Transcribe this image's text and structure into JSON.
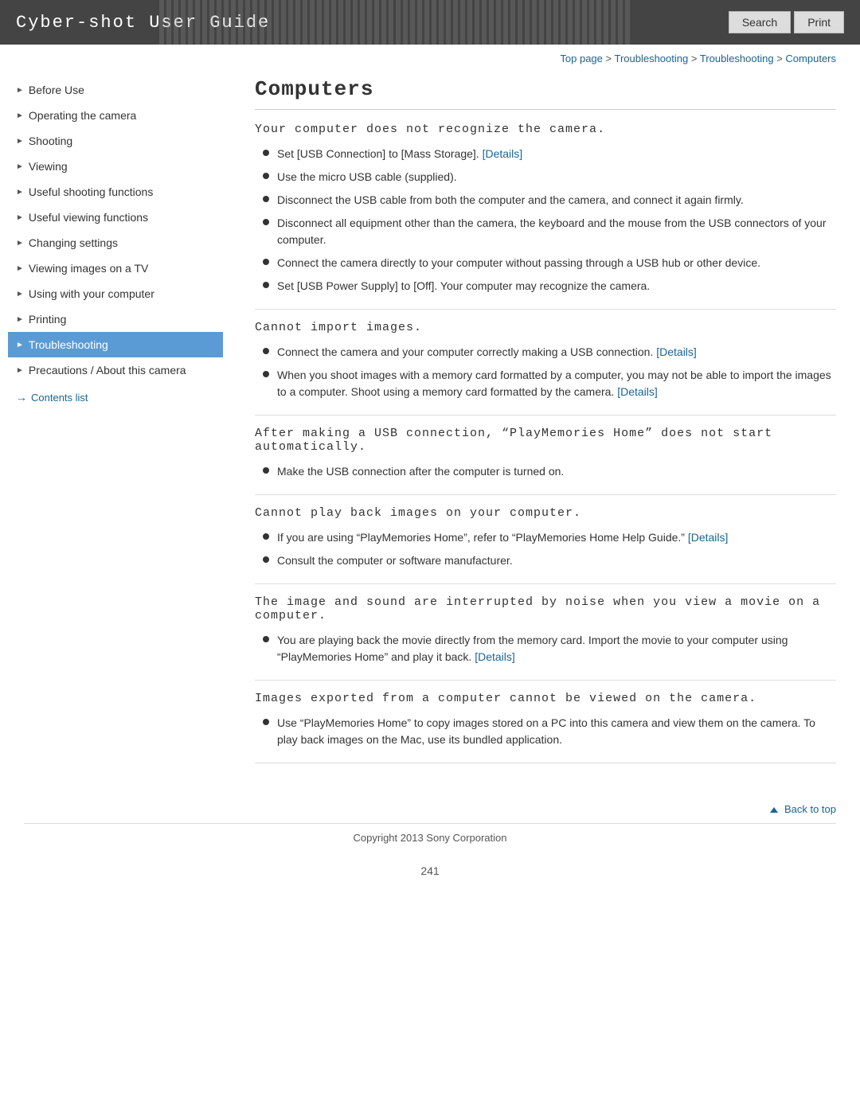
{
  "header": {
    "title": "Cyber-shot User Guide",
    "search_label": "Search",
    "print_label": "Print"
  },
  "breadcrumb": {
    "items": [
      {
        "text": "Top page",
        "link": true
      },
      {
        "text": " > "
      },
      {
        "text": "Troubleshooting",
        "link": true
      },
      {
        "text": " > "
      },
      {
        "text": "Troubleshooting",
        "link": true
      },
      {
        "text": " > "
      },
      {
        "text": "Computers",
        "link": true
      }
    ]
  },
  "sidebar": {
    "items": [
      {
        "label": "Before Use",
        "active": false
      },
      {
        "label": "Operating the camera",
        "active": false
      },
      {
        "label": "Shooting",
        "active": false
      },
      {
        "label": "Viewing",
        "active": false
      },
      {
        "label": "Useful shooting functions",
        "active": false
      },
      {
        "label": "Useful viewing functions",
        "active": false
      },
      {
        "label": "Changing settings",
        "active": false
      },
      {
        "label": "Viewing images on a TV",
        "active": false
      },
      {
        "label": "Using with your computer",
        "active": false
      },
      {
        "label": "Printing",
        "active": false
      },
      {
        "label": "Troubleshooting",
        "active": true
      },
      {
        "label": "Precautions / About this camera",
        "active": false
      }
    ],
    "contents_list": "Contents list"
  },
  "main": {
    "page_title": "Computers",
    "sections": [
      {
        "id": "section1",
        "heading": "Your computer does not recognize the camera.",
        "bullets": [
          {
            "text": "Set [USB Connection] to [Mass Storage]. ",
            "link_text": "[Details]"
          },
          {
            "text": "Use the micro USB cable (supplied)."
          },
          {
            "text": "Disconnect the USB cable from both the computer and the camera, and connect it again firmly."
          },
          {
            "text": "Disconnect all equipment other than the camera, the keyboard and the mouse from the USB connectors of your computer."
          },
          {
            "text": "Connect the camera directly to your computer without passing through a USB hub or other device."
          },
          {
            "text": "Set [USB Power Supply] to [Off]. Your computer may recognize the camera."
          }
        ]
      },
      {
        "id": "section2",
        "heading": "Cannot import images.",
        "bullets": [
          {
            "text": "Connect the camera and your computer correctly making a USB connection. ",
            "link_text": "[Details]"
          },
          {
            "text": "When you shoot images with a memory card formatted by a computer, you may not be able to import the images to a computer. Shoot using a memory card formatted by the camera. ",
            "link_text": "[Details]"
          }
        ]
      },
      {
        "id": "section3",
        "heading": "After making a USB connection, “PlayMemories Home” does not start automatically.",
        "bullets": [
          {
            "text": "Make the USB connection after the computer is turned on."
          }
        ]
      },
      {
        "id": "section4",
        "heading": "Cannot play back images on your computer.",
        "bullets": [
          {
            "text": "If you are using “PlayMemories Home”, refer to “PlayMemories Home Help Guide.” ",
            "link_text": "[Details]"
          },
          {
            "text": "Consult the computer or software manufacturer."
          }
        ]
      },
      {
        "id": "section5",
        "heading": "The image and sound are interrupted by noise when you view a movie on a computer.",
        "bullets": [
          {
            "text": "You are playing back the movie directly from the memory card. Import the movie to your computer using “PlayMemories Home” and play it back. ",
            "link_text": "[Details]"
          }
        ]
      },
      {
        "id": "section6",
        "heading": "Images exported from a computer cannot be viewed on the camera.",
        "bullets": [
          {
            "text": "Use “PlayMemories Home” to copy images stored on a PC into this camera and view them on the camera. To play back images on the Mac, use its bundled application."
          }
        ]
      }
    ],
    "back_to_top": "Back to top",
    "copyright": "Copyright 2013 Sony Corporation",
    "page_number": "241"
  }
}
